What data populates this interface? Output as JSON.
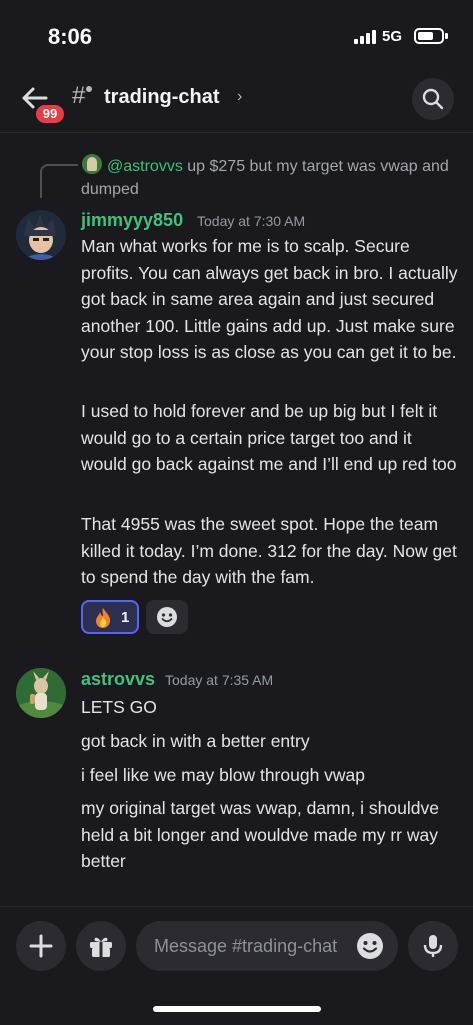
{
  "status_bar": {
    "time": "8:06",
    "network": "5G"
  },
  "header": {
    "unread_badge": "99",
    "channel_name": "trading-chat",
    "chevron": "›"
  },
  "reply_preview": {
    "mention": "@astrovvs",
    "text": "up $275 but my target was vwap and dumped"
  },
  "messages": [
    {
      "username": "jimmyyy850",
      "timestamp": "Today at 7:30 AM",
      "paragraphs": [
        "Man what works for me is to scalp. Secure profits. You can always get back in bro. I actually got back in same area again and just secured another 100. Little gains add up. Just make sure your stop loss is as close as you can get it to be.",
        "I used to hold forever and be up big but I felt it would go to a certain price target too and it would go back against me and I’ll end up red too",
        "That 4955 was the sweet spot. Hope the team killed it today. I’m done. 312 for the day. Now get to spend the day with the fam."
      ],
      "reaction": {
        "emoji": "🔥",
        "count": "1"
      }
    },
    {
      "username": "astrovvs",
      "timestamp": "Today at 7:35 AM",
      "paragraphs": [
        "LETS GO",
        "got back in with a better entry",
        "i feel like we may blow through vwap",
        "my original target was vwap, damn, i shouldve held a bit longer and wouldve made my rr way better"
      ]
    }
  ],
  "input": {
    "placeholder": "Message #trading-chat"
  },
  "icons": {
    "back": "arrow-left-icon",
    "search": "search-icon",
    "plus": "plus-icon",
    "gift": "gift-icon",
    "emoji": "emoji-icon",
    "mic": "microphone-icon",
    "add_reaction": "add-reaction-icon"
  },
  "colors": {
    "background": "#1a1a1e",
    "username": "#3fc37a",
    "mention": "#35c56a",
    "badge": "#e53e44",
    "reaction_border": "#5865f2"
  }
}
